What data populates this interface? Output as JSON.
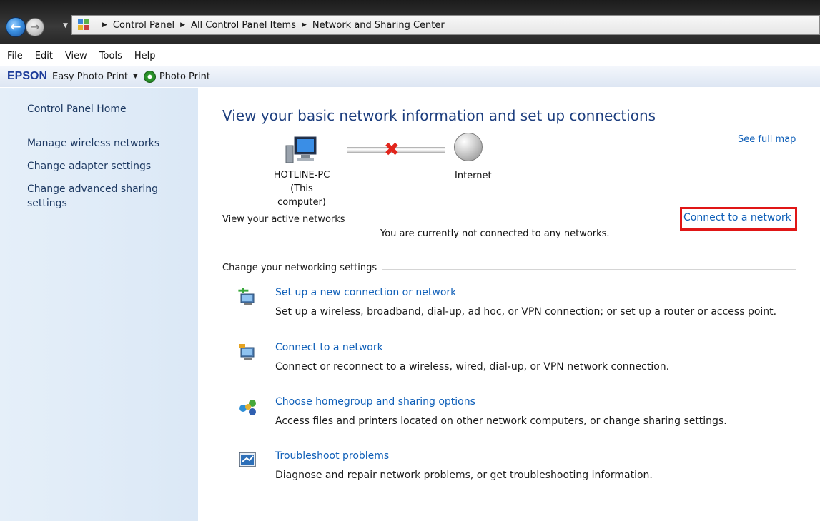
{
  "breadcrumbs": [
    "Control Panel",
    "All Control Panel Items",
    "Network and Sharing Center"
  ],
  "menu": [
    "File",
    "Edit",
    "View",
    "Tools",
    "Help"
  ],
  "toolbar": {
    "brand": "EPSON",
    "easy_photo_print": "Easy Photo Print",
    "photo_print": "Photo Print"
  },
  "sidebar": {
    "home": "Control Panel Home",
    "items": [
      "Manage wireless networks",
      "Change adapter settings",
      "Change advanced sharing",
      "settings"
    ]
  },
  "main": {
    "title": "View your basic network information and set up connections",
    "see_full_map": "See full map",
    "computer_name": "HOTLINE-PC",
    "computer_sub": "(This computer)",
    "internet_label": "Internet",
    "active_networks_label": "View your active networks",
    "connect_link": "Connect to a network",
    "not_connected": "You are currently not connected to any networks.",
    "change_settings_label": "Change your networking settings",
    "tasks": [
      {
        "title": "Set up a new connection or network",
        "desc": "Set up a wireless, broadband, dial-up, ad hoc, or VPN connection; or set up a router or access point.",
        "icon": "new-connection-icon"
      },
      {
        "title": "Connect to a network",
        "desc": "Connect or reconnect to a wireless, wired, dial-up, or VPN network connection.",
        "icon": "connect-network-icon"
      },
      {
        "title": "Choose homegroup and sharing options",
        "desc": "Access files and printers located on other network computers, or change sharing settings.",
        "icon": "homegroup-icon"
      },
      {
        "title": "Troubleshoot problems",
        "desc": "Diagnose and repair network problems, or get troubleshooting information.",
        "icon": "troubleshoot-icon"
      }
    ]
  },
  "colors": {
    "link": "#0f5fb8",
    "title": "#1e3f7f",
    "highlight": "#e01616",
    "sidebar_bg": "#dbe8f6"
  }
}
